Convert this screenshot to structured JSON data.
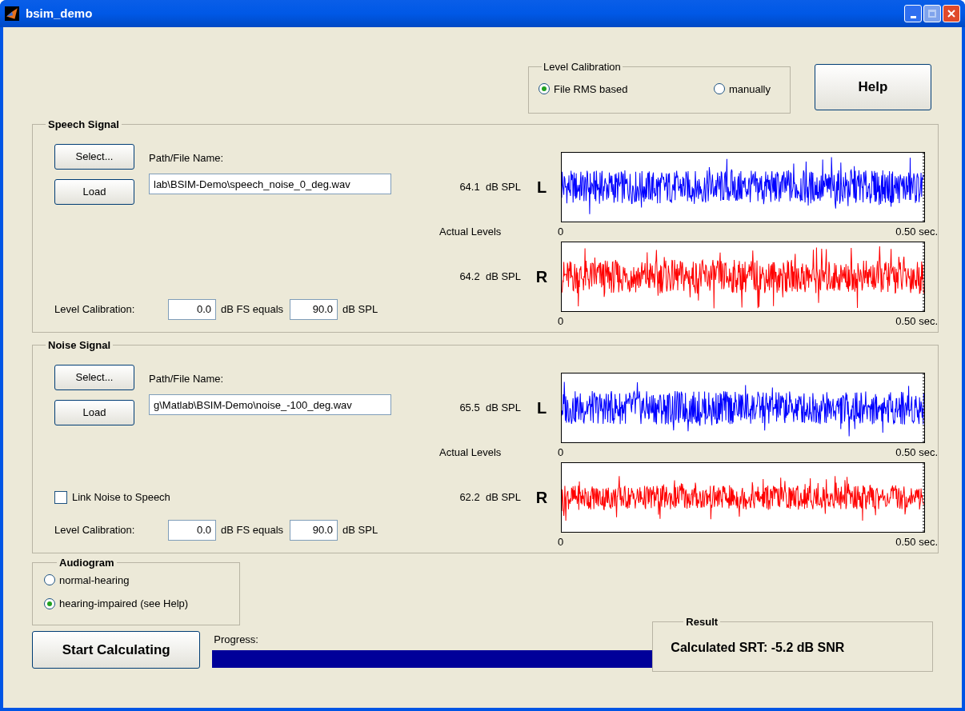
{
  "window": {
    "title": "bsim_demo"
  },
  "level_calibration": {
    "title": "Level Calibration",
    "options": [
      {
        "label": "File RMS based",
        "selected": true
      },
      {
        "label": "manually",
        "selected": false
      }
    ]
  },
  "help_button": "Help",
  "signals": [
    {
      "title": "Speech Signal",
      "select": "Select...",
      "load": "Load",
      "path_label": "Path/File Name:",
      "path": "lab\\BSIM-Demo\\speech_noise_0_deg.wav",
      "calibration": {
        "label": "Level Calibration:",
        "fs_value": "0.0",
        "fs_unit": "dB FS equals",
        "spl_value": "90.0",
        "spl_unit": "dB SPL"
      },
      "actual_levels": "Actual Levels",
      "channels": [
        {
          "value": "64.1",
          "unit": "dB SPL",
          "side": "L",
          "color": "#0000ff",
          "axis_start": "0",
          "axis_end": "0.50 sec."
        },
        {
          "value": "64.2",
          "unit": "dB SPL",
          "side": "R",
          "color": "#ff0000",
          "axis_start": "0",
          "axis_end": "0.50 sec."
        }
      ]
    },
    {
      "title": "Noise Signal",
      "select": "Select...",
      "load": "Load",
      "path_label": "Path/File Name:",
      "path": "g\\Matlab\\BSIM-Demo\\noise_-100_deg.wav",
      "link": {
        "label": "Link Noise to Speech",
        "checked": false
      },
      "calibration": {
        "label": "Level Calibration:",
        "fs_value": "0.0",
        "fs_unit": "dB FS equals",
        "spl_value": "90.0",
        "spl_unit": "dB SPL"
      },
      "actual_levels": "Actual Levels",
      "channels": [
        {
          "value": "65.5",
          "unit": "dB SPL",
          "side": "L",
          "color": "#0000ff",
          "axis_start": "0",
          "axis_end": "0.50 sec."
        },
        {
          "value": "62.2",
          "unit": "dB SPL",
          "side": "R",
          "color": "#ff0000",
          "axis_start": "0",
          "axis_end": "0.50 sec."
        }
      ]
    }
  ],
  "audiogram": {
    "title": "Audiogram",
    "options": [
      {
        "label": "normal-hearing",
        "selected": false
      },
      {
        "label": "hearing-impaired (see Help)",
        "selected": true
      }
    ]
  },
  "start_button": "Start Calculating",
  "progress": {
    "label": "Progress:",
    "level": 1
  },
  "result": {
    "title": "Result",
    "text": "Calculated SRT: -5.2 dB SNR"
  }
}
